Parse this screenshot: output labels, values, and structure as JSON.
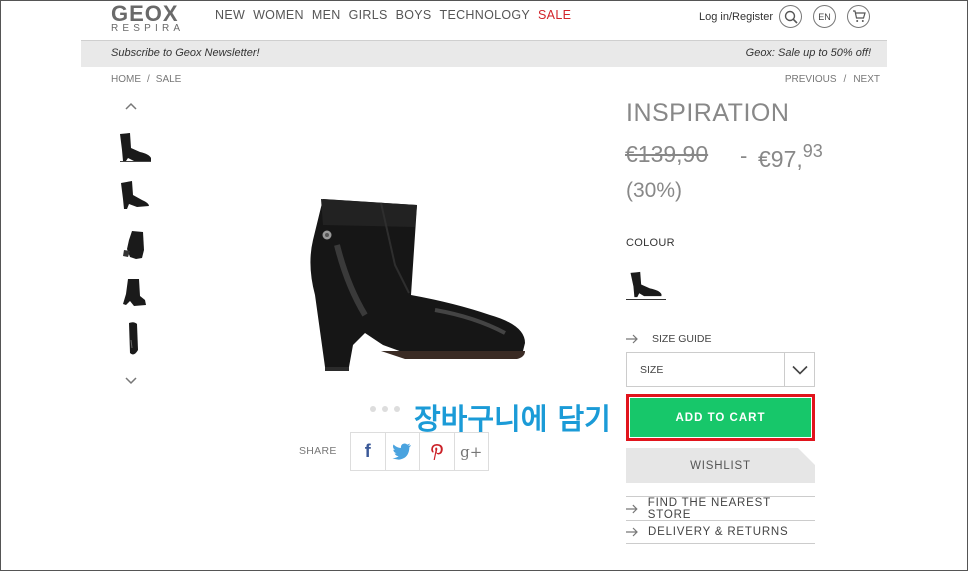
{
  "header": {
    "logo_main": "GEOX",
    "logo_sub": "RESPIRA",
    "nav": [
      "NEW",
      "WOMEN",
      "MEN",
      "GIRLS",
      "BOYS",
      "TECHNOLOGY",
      "SALE"
    ],
    "login": "Log in/Register",
    "lang": "EN"
  },
  "bar": {
    "left": "Subscribe to Geox Newsletter!",
    "right": "Geox: Sale up to 50% off!"
  },
  "breadcrumb": {
    "home": "HOME",
    "sep": "/",
    "current": "SALE"
  },
  "pager": {
    "prev": "PREVIOUS",
    "sep": "/",
    "next": "NEXT"
  },
  "product": {
    "name": "INSPIRATION",
    "price_old": "€139,90",
    "price_dash": "-",
    "price_new_main": "€97,",
    "price_new_cents": "93",
    "discount": "(30%)"
  },
  "colour_label": "COLOUR",
  "size_guide": "SIZE GUIDE",
  "size_select": "SIZE",
  "add_to_cart": "ADD TO CART",
  "wishlist": "WISHLIST",
  "links": [
    "FIND THE NEAREST STORE",
    "DELIVERY & RETURNS"
  ],
  "share_label": "SHARE",
  "share_icons": {
    "facebook": "f",
    "google": "g+"
  },
  "overlay_text": "장바구니에 담기",
  "colors": {
    "accent_green": "#17c76a",
    "highlight_red": "#e1141c",
    "sale_red": "#d2232a",
    "overlay_blue": "#1b9bd7"
  }
}
